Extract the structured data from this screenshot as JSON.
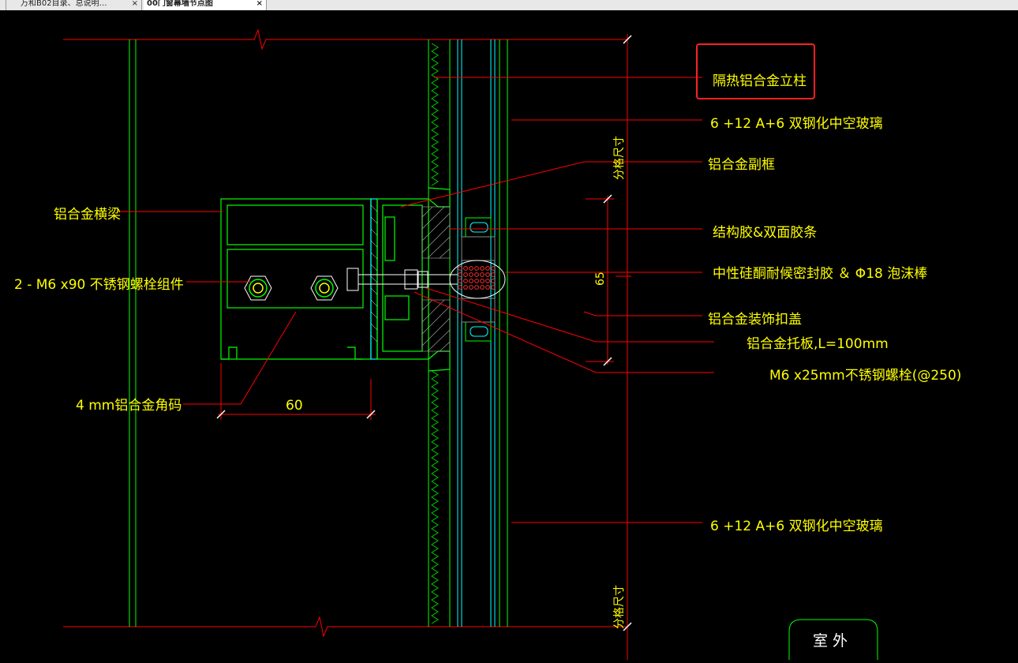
{
  "tabs": [
    {
      "label": "万和B02目录、总说明…",
      "close": "×"
    },
    {
      "label": "00门窗幕墙节点图",
      "close": "×"
    }
  ],
  "labels": {
    "column": "隔热铝合金立柱",
    "glass_top": "6 +12 A+6 双钢化中空玻璃",
    "subframe": "铝合金副框",
    "glue": "结构胶&双面胶条",
    "sealant": "中性硅酮耐候密封胶 ＆ Φ18 泡沫棒",
    "cover": "铝合金装饰扣盖",
    "plate": "铝合金托板,L=100mm",
    "screw": "M6 x25mm不锈钢螺栓(@250)",
    "glass_bottom": "6 +12 A+6 双钢化中空玻璃",
    "beam": "铝合金横梁",
    "bolt": "2 - M6 x90 不锈钢螺栓组件",
    "angle": "4 mm铝合金角码"
  },
  "dimensions": {
    "width_60": "60",
    "height_65": "65",
    "grid_top": "分格尺寸",
    "grid_bottom": "分格尺寸"
  },
  "outside_label": "室 外",
  "colors": {
    "background": "#000000",
    "annotation_text": "#ffff00",
    "leader_line": "#ff0000",
    "profile": "#00ff00",
    "glass": "#00ffff",
    "highlight_box": "#ff2020"
  }
}
